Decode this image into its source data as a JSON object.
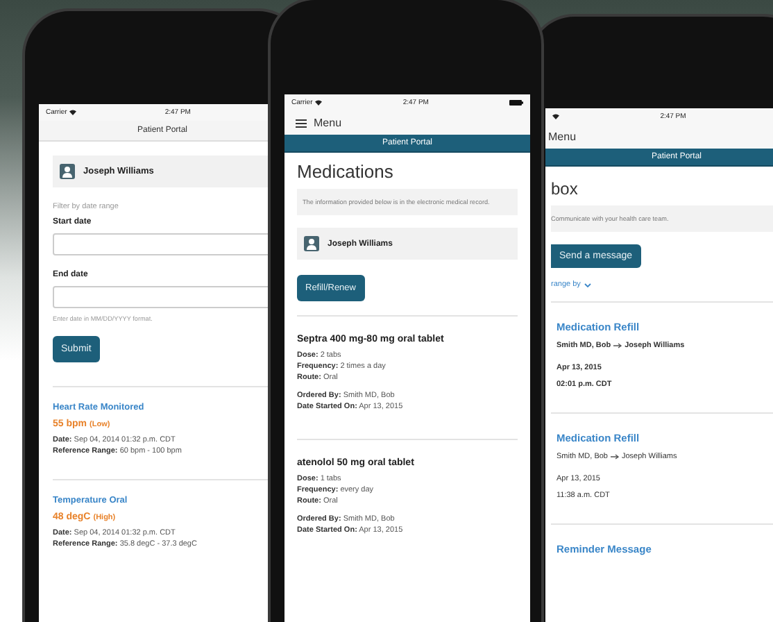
{
  "left_phone": {
    "status": {
      "carrier": "Carrier",
      "time": "2:47 PM"
    },
    "header": "Patient Portal",
    "patient": "Joseph Williams",
    "filter": {
      "caption": "Filter by date range",
      "start_label": "Start date",
      "end_label": "End date",
      "hint": "Enter date in MM/DD/YYYY format.",
      "submit": "Submit"
    },
    "results": [
      {
        "title": "Heart Rate Monitored",
        "value": "55 bpm",
        "flag": "(Low)",
        "fields": [
          {
            "label": "Date:",
            "value": "Sep 04, 2014 01:32 p.m. CDT"
          },
          {
            "label": "Reference Range:",
            "value": "60 bpm - 100 bpm"
          }
        ]
      },
      {
        "title": "Temperature Oral",
        "value": "48 degC",
        "flag": "(High)",
        "fields": [
          {
            "label": "Date:",
            "value": "Sep 04, 2014 01:32 p.m. CDT"
          },
          {
            "label": "Reference Range:",
            "value": "35.8 degC - 37.3 degC"
          }
        ]
      }
    ]
  },
  "middle_phone": {
    "status": {
      "carrier": "Carrier",
      "time": "2:47 PM"
    },
    "menu": "Menu",
    "header": "Patient Portal",
    "title": "Medications",
    "info": "The information provided below is in the electronic medical record.",
    "patient": "Joseph Williams",
    "button": "Refill/Renew",
    "medications": [
      {
        "name": "Septra 400 mg-80 mg oral tablet",
        "groups": [
          [
            {
              "label": "Dose:",
              "value": "2 tabs"
            },
            {
              "label": "Frequency:",
              "value": "2 times a day"
            },
            {
              "label": "Route:",
              "value": "Oral"
            }
          ],
          [
            {
              "label": "Ordered By:",
              "value": "Smith MD, Bob"
            },
            {
              "label": "Date Started On:",
              "value": "Apr 13, 2015"
            }
          ]
        ]
      },
      {
        "name": "atenolol 50 mg oral tablet",
        "groups": [
          [
            {
              "label": "Dose:",
              "value": "1 tabs"
            },
            {
              "label": "Frequency:",
              "value": "every day"
            },
            {
              "label": "Route:",
              "value": "Oral"
            }
          ],
          [
            {
              "label": "Ordered By:",
              "value": "Smith MD, Bob"
            },
            {
              "label": "Date Started On:",
              "value": "Apr 13, 2015"
            }
          ]
        ]
      }
    ]
  },
  "right_phone": {
    "status": {
      "time": "2:47 PM"
    },
    "menu": "Menu",
    "header": "Patient Portal",
    "title": "box",
    "info": "Communicate with your health care team.",
    "button": "Send a message",
    "arrange": "range by",
    "messages": [
      {
        "title": "Medication Refill",
        "from": "Smith MD, Bob",
        "to": "Joseph Williams",
        "date": "Apr 13, 2015",
        "time": "02:01 p.m. CDT",
        "unread": true
      },
      {
        "title": "Medication Refill",
        "from": "Smith MD, Bob",
        "to": "Joseph Williams",
        "date": "Apr 13, 2015",
        "time": "11:38 a.m. CDT",
        "unread": false
      },
      {
        "title": "Reminder Message"
      }
    ]
  }
}
